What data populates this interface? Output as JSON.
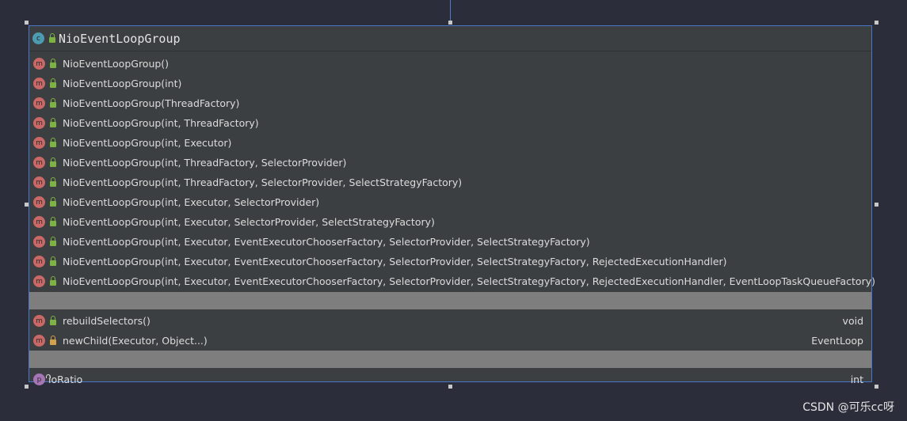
{
  "class": {
    "name": "NioEventLoopGroup",
    "kind_icon": "class-icon",
    "visibility_icon": "lock-icon"
  },
  "constructors": [
    {
      "signature": "NioEventLoopGroup()"
    },
    {
      "signature": "NioEventLoopGroup(int)"
    },
    {
      "signature": "NioEventLoopGroup(ThreadFactory)"
    },
    {
      "signature": "NioEventLoopGroup(int, ThreadFactory)"
    },
    {
      "signature": "NioEventLoopGroup(int, Executor)"
    },
    {
      "signature": "NioEventLoopGroup(int, ThreadFactory, SelectorProvider)"
    },
    {
      "signature": "NioEventLoopGroup(int, ThreadFactory, SelectorProvider, SelectStrategyFactory)"
    },
    {
      "signature": "NioEventLoopGroup(int, Executor, SelectorProvider)"
    },
    {
      "signature": "NioEventLoopGroup(int, Executor, SelectorProvider, SelectStrategyFactory)"
    },
    {
      "signature": "NioEventLoopGroup(int, Executor, EventExecutorChooserFactory, SelectorProvider, SelectStrategyFactory)"
    },
    {
      "signature": "NioEventLoopGroup(int, Executor, EventExecutorChooserFactory, SelectorProvider, SelectStrategyFactory, RejectedExecutionHandler)"
    },
    {
      "signature": "NioEventLoopGroup(int, Executor, EventExecutorChooserFactory, SelectorProvider, SelectStrategyFactory, RejectedExecutionHandler, EventLoopTaskQueueFactory)"
    }
  ],
  "methods": [
    {
      "signature": "rebuildSelectors()",
      "return_type": "void",
      "visibility": "public"
    },
    {
      "signature": "newChild(Executor, Object...)",
      "return_type": "EventLoop",
      "visibility": "protected"
    }
  ],
  "fields": [
    {
      "name": "ioRatio",
      "type": "int"
    }
  ],
  "icon_letters": {
    "class": "c",
    "method": "m",
    "property": "p"
  },
  "colors": {
    "background": "#2b2d3a",
    "panel": "#3c3f41",
    "border": "#4a78c8",
    "divider": "#7e7e7e",
    "method_icon": "#c96866",
    "class_icon": "#4d9bb0",
    "property_icon": "#a576b3",
    "public_lock": "#7cb342",
    "protected_lock": "#d4a24a"
  },
  "watermark": "CSDN @可乐cc呀"
}
